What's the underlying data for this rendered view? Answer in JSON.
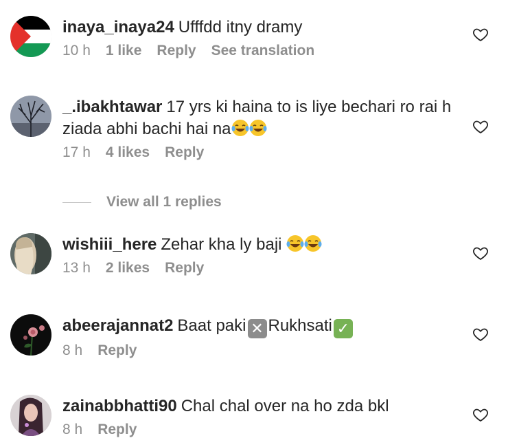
{
  "comments": [
    {
      "username": "inaya_inaya24",
      "text": "Ufffdd itny dramy",
      "time": "10 h",
      "likes": "1 like",
      "reply": "Reply",
      "translate": "See translation",
      "avatar": "palestine-flag"
    },
    {
      "username": "_.ibakhtawar",
      "text": "17 yrs ki haina to is liye bechari ro rai h ziada abhi bachi hai na",
      "emoji": "laughing-tears-emoji",
      "time": "17 h",
      "likes": "4 likes",
      "reply": "Reply",
      "view_replies": "View all 1 replies",
      "avatar": "tree-photo"
    },
    {
      "username": "wishiii_here",
      "text": "Zehar kha ly baji",
      "emoji": "laughing-tears-emoji",
      "time": "13 h",
      "likes": "2 likes",
      "reply": "Reply",
      "avatar": "person-photo"
    },
    {
      "username": "abeerajannat2",
      "text_part1": "Baat paki",
      "text_part2": "Rukhsati",
      "mark_cross": "❌",
      "mark_check": "✅",
      "time": "8 h",
      "reply": "Reply",
      "avatar": "rose-photo"
    },
    {
      "username": "zainabbhatti90",
      "text": "Chal chal over na ho zda bkl",
      "time": "8 h",
      "reply": "Reply",
      "avatar": "girl-photo"
    }
  ],
  "colors": {
    "text": "#262626",
    "muted": "#8e8e8e",
    "cross_box": "#8c8c8c",
    "check_box": "#77b255"
  }
}
